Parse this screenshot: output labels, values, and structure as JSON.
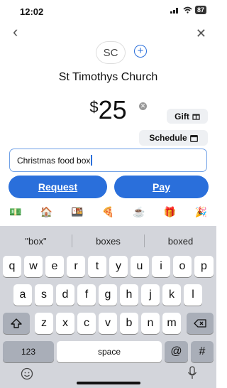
{
  "status_bar": {
    "time": "12:02",
    "battery": "87"
  },
  "recipient": {
    "initials": "SC",
    "name": "St Timothys Church"
  },
  "payment": {
    "currency": "$",
    "amount": "25",
    "gift_label": "Gift",
    "schedule_label": "Schedule"
  },
  "note": {
    "value": "Christmas food box"
  },
  "actions": {
    "request_label": "Request",
    "pay_label": "Pay"
  },
  "emoji_row": [
    "💵",
    "🏠",
    "🍱",
    "🍕",
    "☕",
    "🎁",
    "🎉"
  ],
  "keyboard": {
    "suggestions": [
      "\"box\"",
      "boxes",
      "boxed"
    ],
    "row1": [
      "q",
      "w",
      "e",
      "r",
      "t",
      "y",
      "u",
      "i",
      "o",
      "p"
    ],
    "row2": [
      "a",
      "s",
      "d",
      "f",
      "g",
      "h",
      "j",
      "k",
      "l"
    ],
    "row3": [
      "z",
      "x",
      "c",
      "v",
      "b",
      "n",
      "m"
    ],
    "numbers_label": "123",
    "space_label": "space",
    "at_label": "@",
    "hash_label": "#"
  },
  "colors": {
    "accent": "#2a6fdb",
    "keyboard_bg": "#d3d5db"
  }
}
